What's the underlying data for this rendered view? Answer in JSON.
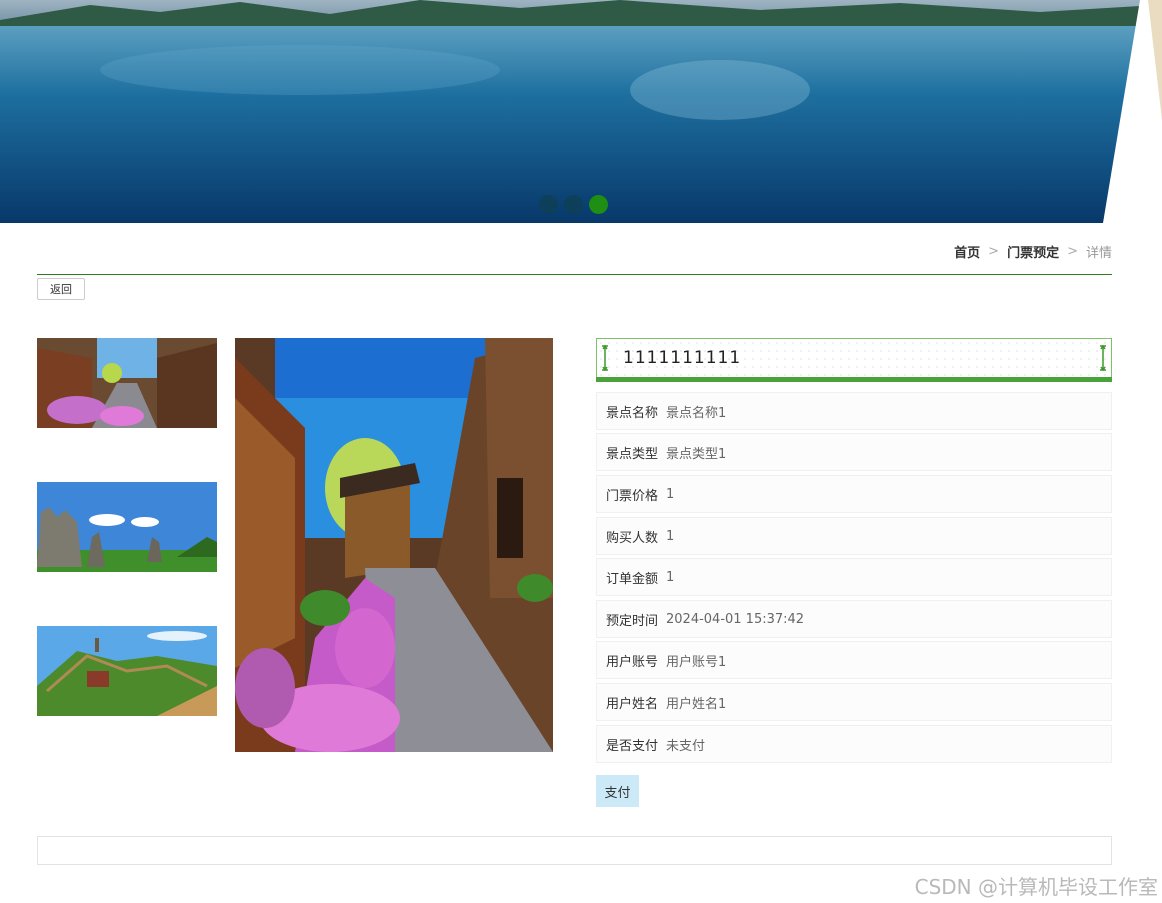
{
  "carousel": {
    "slide_count": 3,
    "active_index": 2
  },
  "breadcrumb": {
    "home": "首页",
    "section": "门票预定",
    "current": "详情",
    "separator": ">"
  },
  "back_label": "返回",
  "detail": {
    "title": "1111111111",
    "fields": [
      {
        "label": "景点名称",
        "value": "景点名称1"
      },
      {
        "label": "景点类型",
        "value": "景点类型1"
      },
      {
        "label": "门票价格",
        "value": "1"
      },
      {
        "label": "购买人数",
        "value": "1"
      },
      {
        "label": "订单金额",
        "value": "1"
      },
      {
        "label": "预定时间",
        "value": "2024-04-01 15:37:42"
      },
      {
        "label": "用户账号",
        "value": "用户账号1"
      },
      {
        "label": "用户姓名",
        "value": "用户姓名1"
      },
      {
        "label": "是否支付",
        "value": "未支付"
      }
    ],
    "pay_label": "支付"
  },
  "watermark": "CSDN @计算机毕设工作室",
  "colors": {
    "accent_green": "#4aa23a",
    "rule_green": "#2e7d1e",
    "pay_button_bg": "#cce9f7"
  }
}
